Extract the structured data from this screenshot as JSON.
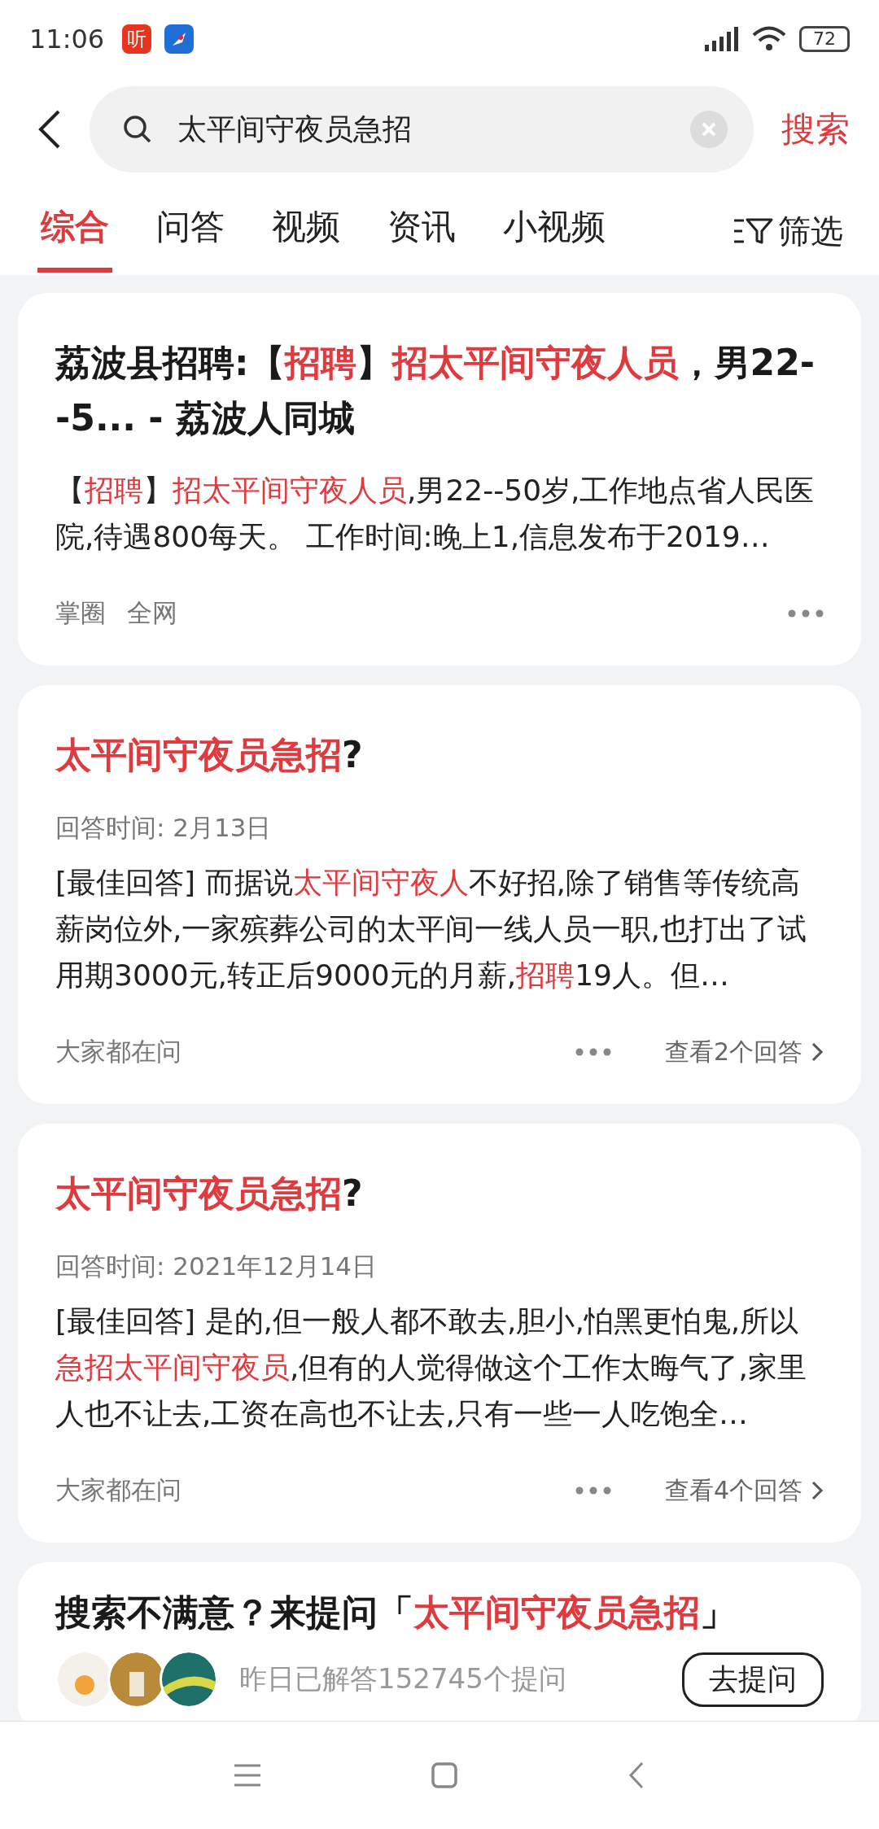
{
  "status_bar": {
    "time": "11:06",
    "app_badge": "听",
    "battery": "72"
  },
  "search": {
    "value": "太平间守夜员急招",
    "action": "搜索"
  },
  "tabs": [
    {
      "label": "综合",
      "selected": true
    },
    {
      "label": "问答",
      "selected": false
    },
    {
      "label": "视频",
      "selected": false
    },
    {
      "label": "资讯",
      "selected": false
    },
    {
      "label": "小视频",
      "selected": false
    }
  ],
  "filter": {
    "label": "筛选"
  },
  "results": [
    {
      "kind": "article",
      "title": [
        {
          "text": "荔波县招聘:【",
          "hl": false
        },
        {
          "text": "招聘",
          "hl": true
        },
        {
          "text": "】",
          "hl": false
        },
        {
          "text": "招太平间守夜人员",
          "hl": true
        },
        {
          "text": "，男22--5... - 荔波人同城",
          "hl": false
        }
      ],
      "body": [
        {
          "text": "【",
          "hl": false
        },
        {
          "text": "招聘",
          "hl": true
        },
        {
          "text": "】",
          "hl": false
        },
        {
          "text": "招太平间守夜人员",
          "hl": true
        },
        {
          "text": ",男22--50岁,工作地点省人民医院,待遇800每天。 工作时间:晚上1,信息发布于2019…",
          "hl": false
        }
      ],
      "sources": [
        "掌圈",
        "全网"
      ]
    },
    {
      "kind": "qa",
      "title": [
        {
          "text": "太平间守夜员急招",
          "hl": true
        },
        {
          "text": "?",
          "hl": false
        }
      ],
      "answer_time": "回答时间: 2月13日",
      "body": [
        {
          "text": "[最佳回答] 而据说",
          "hl": false
        },
        {
          "text": "太平间守夜人",
          "hl": true
        },
        {
          "text": "不好招,除了销售等传统高薪岗位外,一家殡葬公司的太平间一线人员一职,也打出了试用期3000元,转正后9000元的月薪,",
          "hl": false
        },
        {
          "text": "招聘",
          "hl": true
        },
        {
          "text": "19人。但…",
          "hl": false
        }
      ],
      "footer_label": "大家都在问",
      "more_answers": "查看2个回答"
    },
    {
      "kind": "qa",
      "title": [
        {
          "text": "太平间守夜员急招",
          "hl": true
        },
        {
          "text": "?",
          "hl": false
        }
      ],
      "answer_time": "回答时间: 2021年12月14日",
      "body": [
        {
          "text": "[最佳回答] 是的,但一般人都不敢去,胆小,怕黑更怕鬼,所以",
          "hl": false
        },
        {
          "text": "急招太平间守夜员",
          "hl": true
        },
        {
          "text": ",但有的人觉得做这个工作太晦气了,家里人也不让去,工资在高也不让去,只有一些一人吃饱全…",
          "hl": false
        }
      ],
      "footer_label": "大家都在问",
      "more_answers": "查看4个回答"
    }
  ],
  "ask_card": {
    "title": [
      {
        "text": "搜索不满意？来提问「",
        "hl": false
      },
      {
        "text": "太平间守夜员急招",
        "hl": true
      },
      {
        "text": "」",
        "hl": false
      }
    ],
    "answered_count": "昨日已解答152745个提问",
    "button": "去提问"
  }
}
